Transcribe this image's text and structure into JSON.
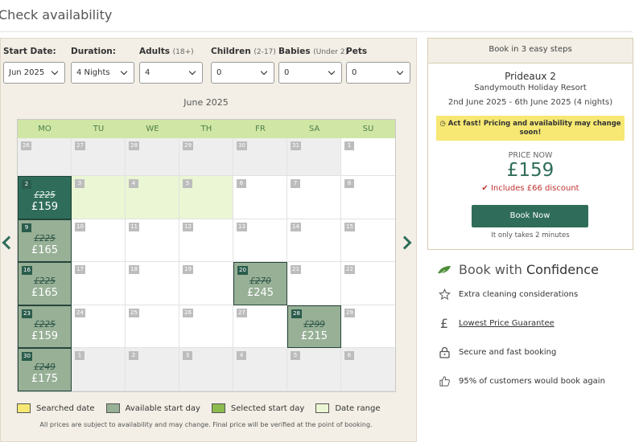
{
  "page": {
    "title": "Check availability"
  },
  "filters": {
    "start_date": {
      "label": "Start Date:",
      "value": "Jun 2025"
    },
    "duration": {
      "label": "Duration:",
      "value": "4 Nights"
    },
    "adults": {
      "label": "Adults",
      "hint": "(18+)",
      "value": "4"
    },
    "children": {
      "label": "Children",
      "hint": "(2-17)",
      "value": "0"
    },
    "babies": {
      "label": "Babies",
      "hint": "(Under 2)",
      "value": "0"
    },
    "pets": {
      "label": "Pets",
      "value": "0"
    }
  },
  "calendar": {
    "month": "June 2025",
    "weekdays": [
      "MO",
      "TU",
      "WE",
      "TH",
      "FR",
      "SA",
      "SU"
    ],
    "days": [
      {
        "day": "26",
        "state": "other"
      },
      {
        "day": "27",
        "state": "other"
      },
      {
        "day": "28",
        "state": "other"
      },
      {
        "day": "29",
        "state": "other"
      },
      {
        "day": "30",
        "state": "other"
      },
      {
        "day": "31",
        "state": "other"
      },
      {
        "day": "1",
        "state": "normal"
      },
      {
        "day": "2",
        "state": "selected",
        "old_price": "£225",
        "price": "£159"
      },
      {
        "day": "3",
        "state": "range"
      },
      {
        "day": "4",
        "state": "range"
      },
      {
        "day": "5",
        "state": "range"
      },
      {
        "day": "6",
        "state": "normal"
      },
      {
        "day": "7",
        "state": "normal"
      },
      {
        "day": "8",
        "state": "normal"
      },
      {
        "day": "9",
        "state": "avail",
        "old_price": "£225",
        "price": "£165"
      },
      {
        "day": "10",
        "state": "normal"
      },
      {
        "day": "11",
        "state": "normal"
      },
      {
        "day": "12",
        "state": "normal"
      },
      {
        "day": "13",
        "state": "normal"
      },
      {
        "day": "14",
        "state": "normal"
      },
      {
        "day": "15",
        "state": "normal"
      },
      {
        "day": "16",
        "state": "avail",
        "old_price": "£225",
        "price": "£165"
      },
      {
        "day": "17",
        "state": "normal"
      },
      {
        "day": "18",
        "state": "normal"
      },
      {
        "day": "19",
        "state": "normal"
      },
      {
        "day": "20",
        "state": "avail",
        "old_price": "£270",
        "price": "£245"
      },
      {
        "day": "21",
        "state": "normal"
      },
      {
        "day": "22",
        "state": "normal"
      },
      {
        "day": "23",
        "state": "avail",
        "old_price": "£225",
        "price": "£159"
      },
      {
        "day": "24",
        "state": "normal"
      },
      {
        "day": "25",
        "state": "normal"
      },
      {
        "day": "26",
        "state": "normal"
      },
      {
        "day": "27",
        "state": "normal"
      },
      {
        "day": "28",
        "state": "avail",
        "old_price": "£299",
        "price": "£215"
      },
      {
        "day": "29",
        "state": "normal"
      },
      {
        "day": "30",
        "state": "avail",
        "old_price": "£249",
        "price": "£175"
      },
      {
        "day": "1",
        "state": "other"
      },
      {
        "day": "2",
        "state": "other"
      },
      {
        "day": "3",
        "state": "other"
      },
      {
        "day": "4",
        "state": "other"
      },
      {
        "day": "5",
        "state": "other"
      },
      {
        "day": "6",
        "state": "other"
      }
    ]
  },
  "legend": {
    "items": [
      {
        "label": "Searched date",
        "color": "#f6e873"
      },
      {
        "label": "Available start day",
        "color": "#97b096"
      },
      {
        "label": "Selected start day",
        "color": "#8dbb4e"
      },
      {
        "label": "Date range",
        "color": "#eaf6d4"
      }
    ],
    "note": "All prices are subject to availability and may change. Final price will be verified at the point of booking."
  },
  "booking": {
    "header": "Book in 3 easy steps",
    "property": "Prideaux 2",
    "resort": "Sandymouth Holiday Resort",
    "dates": "2nd June 2025 - 6th June 2025 (4 nights)",
    "alert": "Act fast! Pricing and availability may change soon!",
    "price_label": "PRICE NOW",
    "price": "£159",
    "discount": "Includes £66 discount",
    "button": "Book Now",
    "button_note": "It only takes 2 minutes"
  },
  "confidence": {
    "title_prefix": "Book with",
    "title_strong": "Confidence",
    "items": [
      {
        "icon": "star-icon",
        "text": "Extra cleaning considerations"
      },
      {
        "icon": "pound-icon",
        "text": "Lowest Price Guarantee"
      },
      {
        "icon": "lock-icon",
        "text": "Secure and fast booking"
      },
      {
        "icon": "thumbs-up-icon",
        "text": "95% of customers would book again"
      }
    ]
  },
  "colors": {
    "accent": "#2f6d5a",
    "available": "#97b096",
    "range": "#eaf6d4",
    "alert": "#f6e873",
    "discount": "#c03030"
  }
}
